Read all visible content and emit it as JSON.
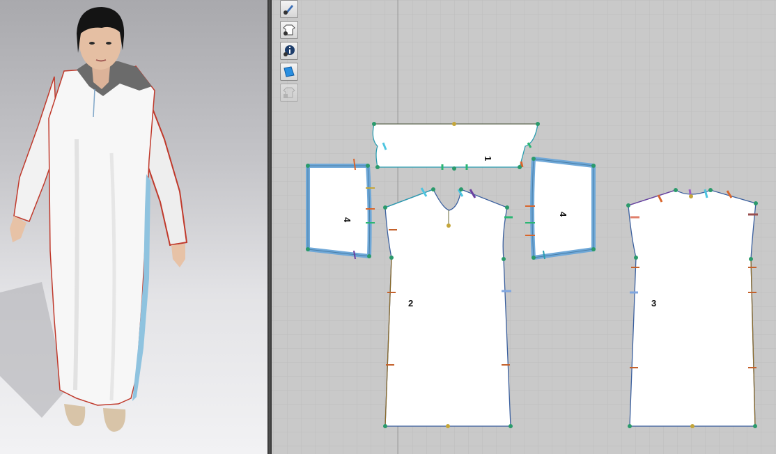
{
  "viewport_3d": {
    "avatar": "female-avatar-in-white-hooded-robe",
    "colors": {
      "fabric": "#f6f6f6",
      "hood": "#6b6b6b",
      "seam_highlight": "#c0392b",
      "selection": "#8fc3df"
    }
  },
  "viewport_2d": {
    "toolbar": [
      {
        "icon": "pencil-eye-icon",
        "enabled": true
      },
      {
        "icon": "shirt-eye-icon",
        "enabled": true
      },
      {
        "icon": "info-eye-icon",
        "enabled": true
      },
      {
        "icon": "fabric-sheet-icon",
        "enabled": true
      },
      {
        "icon": "lock-shirt-icon",
        "enabled": false
      }
    ],
    "pattern_pieces": [
      {
        "id": "piece-1",
        "label": "1",
        "role": "hood-band"
      },
      {
        "id": "piece-2",
        "label": "2",
        "role": "front-body"
      },
      {
        "id": "piece-3",
        "label": "3",
        "role": "back-body"
      },
      {
        "id": "piece-4-left",
        "label": "4",
        "role": "sleeve",
        "selected": true
      },
      {
        "id": "piece-4-right",
        "label": "4",
        "role": "sleeve",
        "selected": true
      }
    ],
    "colors": {
      "grid_bg": "#c9c9c9",
      "grid_line": "#bdbdbd",
      "selection_outline": "#6fa8d8",
      "piece_fill": "#ffffff"
    }
  }
}
